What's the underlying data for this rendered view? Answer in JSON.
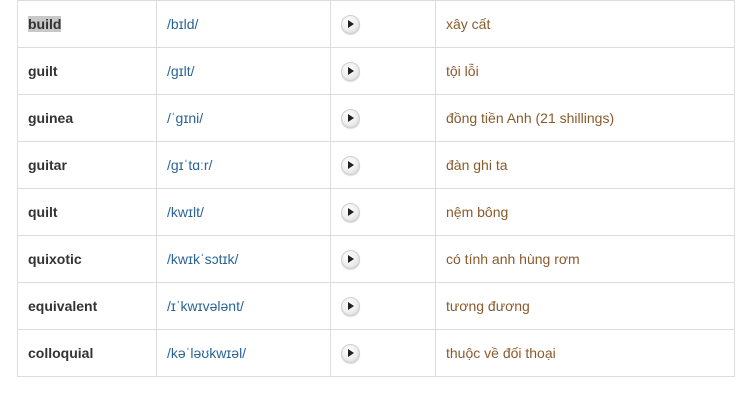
{
  "rows": [
    {
      "word": "build",
      "ipa": "/bɪld/",
      "meaning": "xây cất",
      "selected": true
    },
    {
      "word": "guilt",
      "ipa": "/gɪlt/",
      "meaning": "tội lỗi"
    },
    {
      "word": "guinea",
      "ipa": "/ˈgɪni/",
      "meaning": "đồng tiền Anh (21 shillings)"
    },
    {
      "word": "guitar",
      "ipa": "/gɪˈtɑːr/",
      "meaning": "đàn ghi ta"
    },
    {
      "word": "quilt",
      "ipa": "/kwɪlt/",
      "meaning": "nệm bông"
    },
    {
      "word": "quixotic",
      "ipa": "/kwɪkˈsɔtɪk/",
      "meaning": "có tính anh hùng rơm"
    },
    {
      "word": "equivalent",
      "ipa": "/ɪˈkwɪvələnt/",
      "meaning": "tương đương"
    },
    {
      "word": "colloquial",
      "ipa": "/kəˈləʊkwɪəl/",
      "meaning": "thuộc về đối thoại"
    }
  ],
  "icons": {
    "play": "play-icon"
  },
  "colors": {
    "ipa": "#2a6496",
    "meaning": "#8a5a2b",
    "selection": "#c8c8c8",
    "border": "#dddddd"
  }
}
